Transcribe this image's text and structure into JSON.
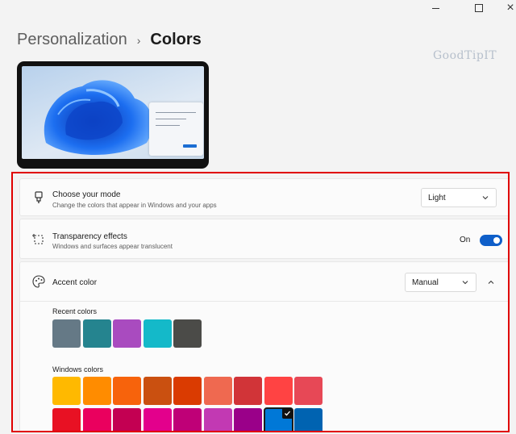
{
  "window_controls": {
    "minimize": "minimize",
    "maximize": "maximize",
    "close": "×"
  },
  "breadcrumb": {
    "parent": "Personalization",
    "separator": "›",
    "current": "Colors"
  },
  "watermark": "GoodTipIT",
  "settings": {
    "mode": {
      "title": "Choose your mode",
      "description": "Change the colors that appear in Windows and your apps",
      "value": "Light",
      "icon": "paintbrush-icon"
    },
    "transparency": {
      "title": "Transparency effects",
      "description": "Windows and surfaces appear translucent",
      "state_label": "On",
      "enabled": true,
      "icon": "transparency-icon"
    },
    "accent": {
      "title": "Accent color",
      "value": "Manual",
      "expanded": true,
      "icon": "palette-icon"
    }
  },
  "recent_colors": {
    "label": "Recent colors",
    "colors": [
      "#657986",
      "#25848f",
      "#a94bbf",
      "#14b9c9",
      "#4b4b48"
    ]
  },
  "windows_colors": {
    "label": "Windows colors",
    "row1": [
      "#ffb900",
      "#ff8c00",
      "#f7630c",
      "#ca5010",
      "#da3b01",
      "#ef6950",
      "#d13438",
      "#ff4343",
      "#e74856"
    ],
    "row2": [
      "#e81123",
      "#ea005e",
      "#c30052",
      "#e3008c",
      "#bf0077",
      "#c239b3",
      "#9a0089",
      "#0078d7",
      "#0063b1"
    ],
    "selected": "#0078d7"
  },
  "colors": {
    "accent": "#0f5fc9",
    "highlight_border": "#e00000"
  }
}
